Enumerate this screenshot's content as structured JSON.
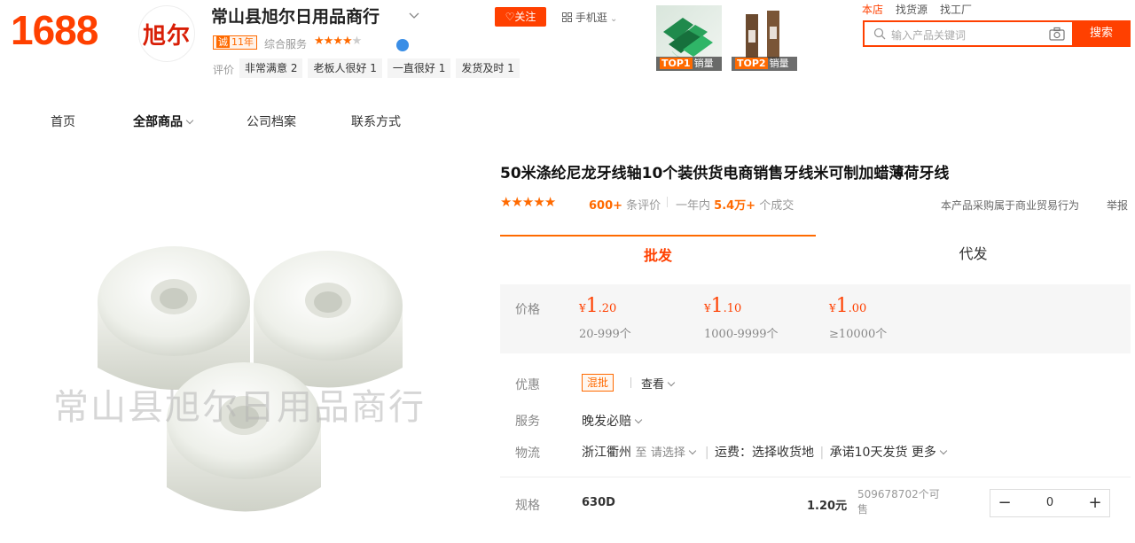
{
  "header": {
    "logo": "1688",
    "shop_avatar_text": "旭尔",
    "shop_name": "常山县旭尔日用品商行",
    "years_badge_icon": "诚",
    "years_badge_text": "11年",
    "service_label": "综合服务",
    "service_rating": 4,
    "review_label": "评价",
    "review_tags": [
      "非常满意 2",
      "老板人很好 1",
      "一直很好 1",
      "发货及时 1"
    ],
    "follow_label": "关注",
    "phone_label": "手机逛",
    "top_products": [
      {
        "rank": "TOP1",
        "label": "销量"
      },
      {
        "rank": "TOP2",
        "label": "销量"
      }
    ],
    "search_tabs": [
      "本店",
      "找货源",
      "找工厂"
    ],
    "search_placeholder": "输入产品关键词",
    "search_button": "搜索"
  },
  "nav": {
    "items": [
      "首页",
      "全部商品",
      "公司档案",
      "联系方式"
    ],
    "active_index": 1
  },
  "product": {
    "watermark": "常山县旭尔日用品商行",
    "title": "50米涤纶尼龙牙线轴10个装供货电商销售牙线米可制加蜡薄荷牙线",
    "rating": 5,
    "review_count": "600+",
    "review_suffix": "条评价",
    "yearly_prefix": "一年内",
    "yearly_count": "5.4万+",
    "yearly_suffix": "个成交",
    "trade_note": "本产品采购属于商业贸易行为",
    "report": "举报"
  },
  "tabs": [
    "批发",
    "代发"
  ],
  "price": {
    "label": "价格",
    "tiers": [
      {
        "yen": "¥",
        "int": "1",
        "dec": ".20",
        "range": "20-999个"
      },
      {
        "yen": "¥",
        "int": "1",
        "dec": ".10",
        "range": "1000-9999个"
      },
      {
        "yen": "¥",
        "int": "1",
        "dec": ".00",
        "range": "≥10000个"
      }
    ]
  },
  "discount": {
    "label": "优惠",
    "tag": "混批",
    "view": "查看"
  },
  "service": {
    "label": "服务",
    "value": "晚发必赔"
  },
  "logistics": {
    "label": "物流",
    "origin": "浙江衢州",
    "to": "至",
    "select": "请选择",
    "fee_label": "运费：选择收货地",
    "promise": "承诺10天发货",
    "more": "更多"
  },
  "spec": {
    "label": "规格",
    "name": "630D",
    "price": "1.20元",
    "stock": "509678702个可售",
    "quantity": "0",
    "minus": "−",
    "plus": "+"
  },
  "colors": {
    "brand": "#ff4000",
    "accent": "#ff6a00"
  }
}
